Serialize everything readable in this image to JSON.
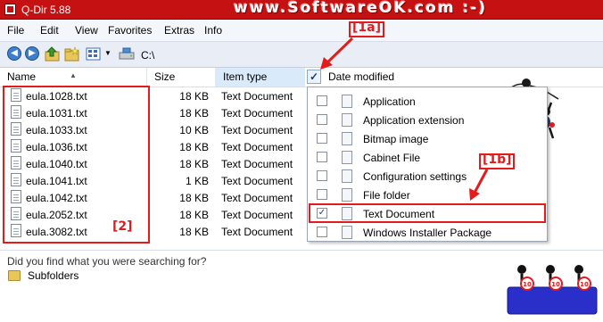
{
  "window": {
    "title": "Q-Dir 5.88",
    "watermark": "www.SoftwareOK.com :-)"
  },
  "menu": [
    "File",
    "Edit",
    "View",
    "Favorites",
    "Extras",
    "Info"
  ],
  "toolbar": {
    "path": "C:\\"
  },
  "columns": {
    "name": "Name",
    "size": "Size",
    "type": "Item type",
    "date": "Date modified"
  },
  "files": [
    {
      "name": "eula.1028.txt",
      "size": "18 KB",
      "type": "Text Document"
    },
    {
      "name": "eula.1031.txt",
      "size": "18 KB",
      "type": "Text Document"
    },
    {
      "name": "eula.1033.txt",
      "size": "10 KB",
      "type": "Text Document"
    },
    {
      "name": "eula.1036.txt",
      "size": "18 KB",
      "type": "Text Document"
    },
    {
      "name": "eula.1040.txt",
      "size": "18 KB",
      "type": "Text Document"
    },
    {
      "name": "eula.1041.txt",
      "size": "1 KB",
      "type": "Text Document"
    },
    {
      "name": "eula.1042.txt",
      "size": "18 KB",
      "type": "Text Document"
    },
    {
      "name": "eula.2052.txt",
      "size": "18 KB",
      "type": "Text Document"
    },
    {
      "name": "eula.3082.txt",
      "size": "18 KB",
      "type": "Text Document"
    }
  ],
  "filter_menu": [
    {
      "label": "Application",
      "checked": false
    },
    {
      "label": "Application extension",
      "checked": false
    },
    {
      "label": "Bitmap image",
      "checked": false
    },
    {
      "label": "Cabinet File",
      "checked": false
    },
    {
      "label": "Configuration settings",
      "checked": false
    },
    {
      "label": "File folder",
      "checked": false
    },
    {
      "label": "Text Document",
      "checked": true
    },
    {
      "label": "Windows Installer Package",
      "checked": false
    }
  ],
  "bottom": {
    "question": "Did you find what you were searching for?",
    "subfolders": "Subfolders"
  },
  "annotations": {
    "a1a": "[1a]",
    "a1b": "[1b]",
    "a2": "[2]"
  },
  "colors": {
    "title_bar": "#c51111",
    "annotation_red": "#e31b1b",
    "header_highlight": "#d9ebfb"
  }
}
